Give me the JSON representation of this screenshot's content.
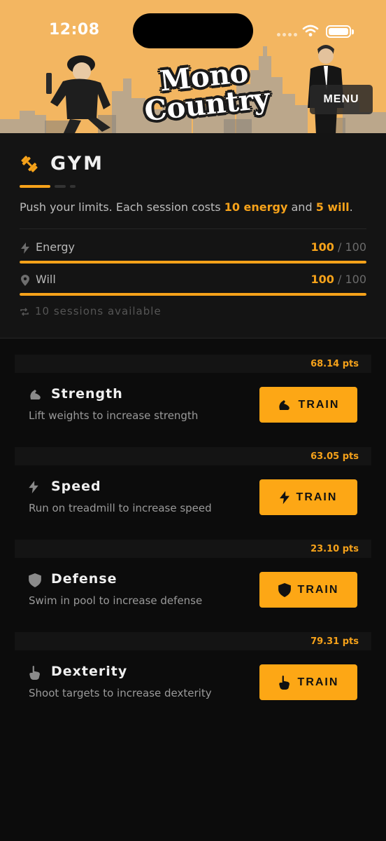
{
  "status_bar": {
    "time": "12:08"
  },
  "header": {
    "logo_line1": "Mono",
    "logo_line2": "Country",
    "menu_label": "MENU"
  },
  "gym": {
    "title": "GYM",
    "description_prefix": "Push your limits. Each session costs ",
    "energy_cost": "10 energy",
    "description_mid": " and ",
    "will_cost": "5 will",
    "description_suffix": ".",
    "stats": [
      {
        "label": "Energy",
        "current": "100",
        "separator": "/",
        "max": "100",
        "fill_percent": 100,
        "icon": "bolt-icon"
      },
      {
        "label": "Will",
        "current": "100",
        "separator": "/",
        "max": "100",
        "fill_percent": 100,
        "icon": "location-pin-icon"
      }
    ],
    "sessions_text": "10 sessions available"
  },
  "trainings": [
    {
      "name": "Strength",
      "description": "Lift weights to increase strength",
      "points": "68.14 pts",
      "button_label": "TRAIN",
      "icon": "flexed-arm-icon"
    },
    {
      "name": "Speed",
      "description": "Run on treadmill to increase speed",
      "points": "63.05 pts",
      "button_label": "TRAIN",
      "icon": "bolt-icon"
    },
    {
      "name": "Defense",
      "description": "Swim in pool to increase defense",
      "points": "23.10 pts",
      "button_label": "TRAIN",
      "icon": "shield-icon"
    },
    {
      "name": "Dexterity",
      "description": "Shoot targets to increase dexterity",
      "points": "79.31 pts",
      "button_label": "TRAIN",
      "icon": "pointing-hand-icon"
    }
  ],
  "colors": {
    "accent": "#f6a21a",
    "button": "#fda715",
    "header_bg": "#f3b661",
    "page_bg": "#0c0c0c",
    "panel_bg": "#141414"
  }
}
